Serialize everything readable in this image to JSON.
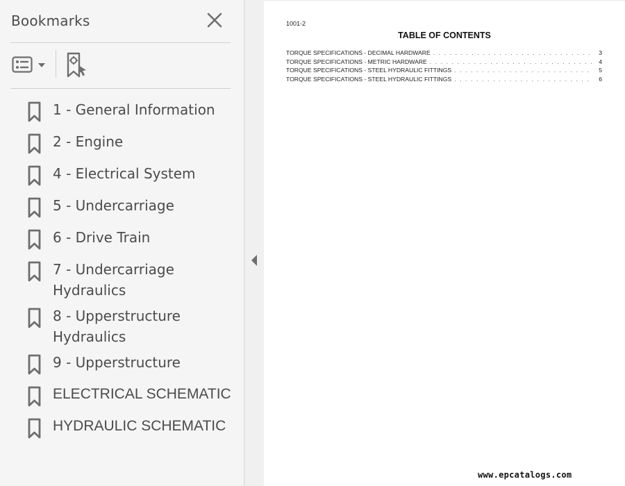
{
  "sidebar": {
    "title": "Bookmarks",
    "close_icon": "close-icon",
    "toolbar": {
      "options_icon": "list-options-icon",
      "new_bookmark_icon": "add-bookmark-icon"
    },
    "items": [
      {
        "label": "1 - General Information"
      },
      {
        "label": "2 - Engine"
      },
      {
        "label": "4 - Electrical System"
      },
      {
        "label": "5 - Undercarriage"
      },
      {
        "label": "6 - Drive Train"
      },
      {
        "label": "7 - Undercarriage Hydraulics"
      },
      {
        "label": "8 - Upperstructure Hydraulics"
      },
      {
        "label": "9 - Upperstructure"
      },
      {
        "label": "ELECTRICAL SCHEMATIC"
      },
      {
        "label": "HYDRAULIC SCHEMATIC"
      }
    ],
    "collapse_icon": "collapse-left-icon"
  },
  "document": {
    "page_id": "1001-2",
    "title": "TABLE OF CONTENTS",
    "toc": [
      {
        "text": "TORQUE SPECIFICATIONS - DECIMAL HARDWARE",
        "page": "3"
      },
      {
        "text": "TORQUE SPECIFICATIONS - METRIC HARDWARE",
        "page": "4"
      },
      {
        "text": "TORQUE SPECIFICATIONS - STEEL HYDRAULIC FITTINGS",
        "page": "5"
      },
      {
        "text": "TORQUE SPECIFICATIONS - STEEL HYDRAULIC FITTINGS",
        "page": "6"
      }
    ],
    "watermark": "www.epcatalogs.com"
  },
  "colors": {
    "sidebar_bg": "#f5f5f5",
    "icon_gray": "#6e6e6e",
    "text_gray": "#4b4b4b"
  }
}
